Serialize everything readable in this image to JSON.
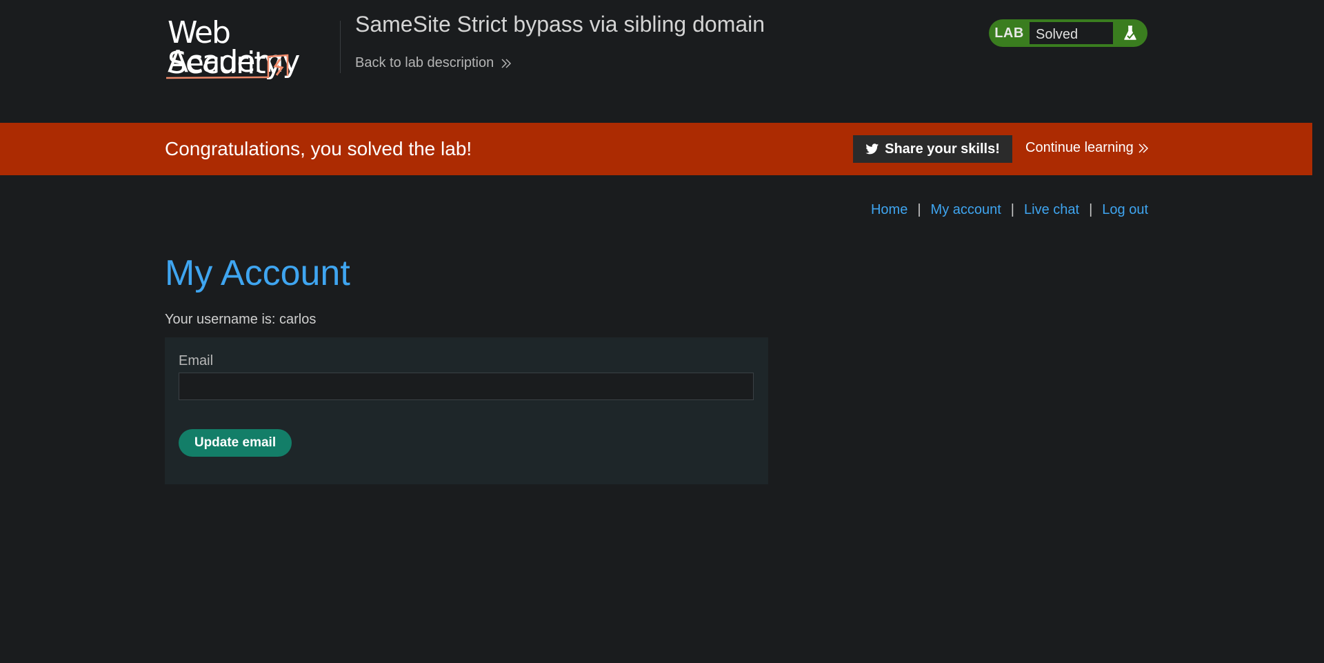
{
  "header": {
    "logo_line1": "Web Security",
    "logo_line2": "Academy",
    "lab_title": "SameSite Strict bypass via sibling domain",
    "back_link": "Back to lab description",
    "lab_tag": "LAB",
    "lab_status": "Solved"
  },
  "banner": {
    "message": "Congratulations, you solved the lab!",
    "share_label": "Share your skills!",
    "continue_label": "Continue learning",
    "color": "#ac2b02"
  },
  "nav": {
    "items": [
      "Home",
      "My account",
      "Live chat",
      "Log out"
    ],
    "separator": "|"
  },
  "main": {
    "title": "My Account",
    "username_text": "Your username is: carlos",
    "email_label": "Email",
    "email_value": "",
    "update_label": "Update email"
  },
  "icons": {
    "back": "double-chevron-right-icon",
    "share": "twitter-icon",
    "flask": "flask-icon"
  },
  "colors": {
    "accent_link": "#3fa5f0",
    "lab_solved": "#3a7d1f",
    "update_button": "#137e68",
    "background": "#1a1c1e"
  }
}
